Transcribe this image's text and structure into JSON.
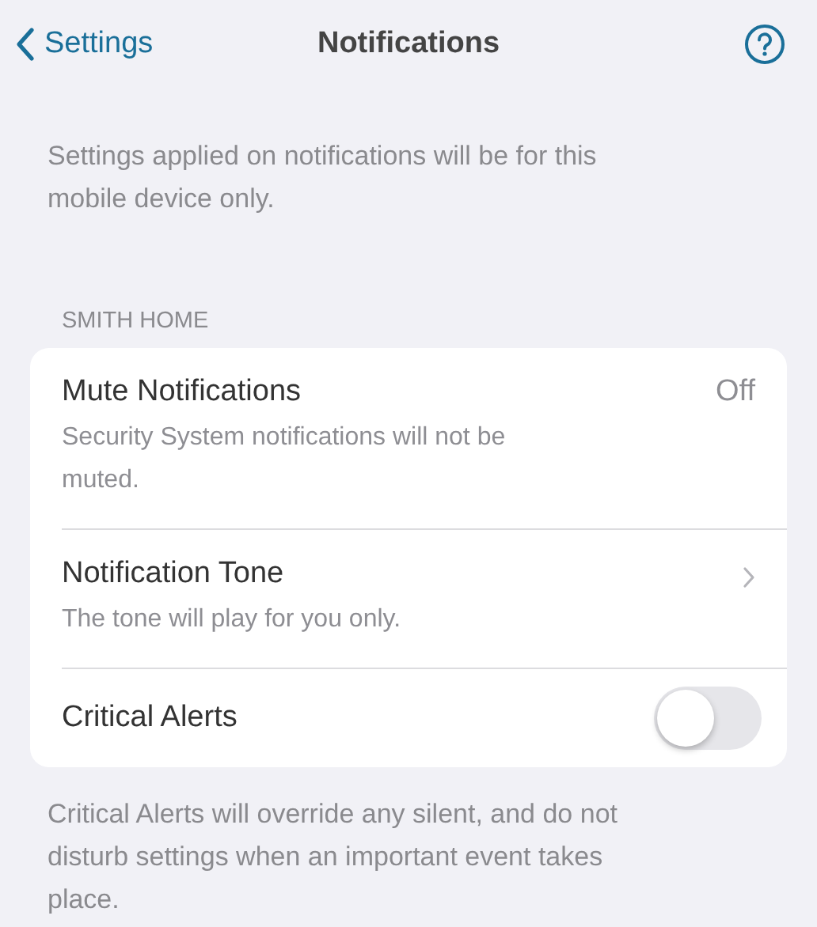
{
  "nav": {
    "back_label": "Settings",
    "title": "Notifications"
  },
  "intro": "Settings applied on notifications will be for this mobile device only.",
  "section": {
    "header": "SMITH HOME",
    "rows": [
      {
        "kind": "value",
        "title": "Mute Notifications",
        "subtitle": "Security System notifications will not be muted.",
        "value": "Off"
      },
      {
        "kind": "disclosure",
        "title": "Notification Tone",
        "subtitle": "The tone will play for you only."
      },
      {
        "kind": "toggle",
        "title": "Critical Alerts",
        "on": false
      }
    ]
  },
  "footer": "Critical Alerts will override any silent, and do not disturb settings when an important event takes place."
}
